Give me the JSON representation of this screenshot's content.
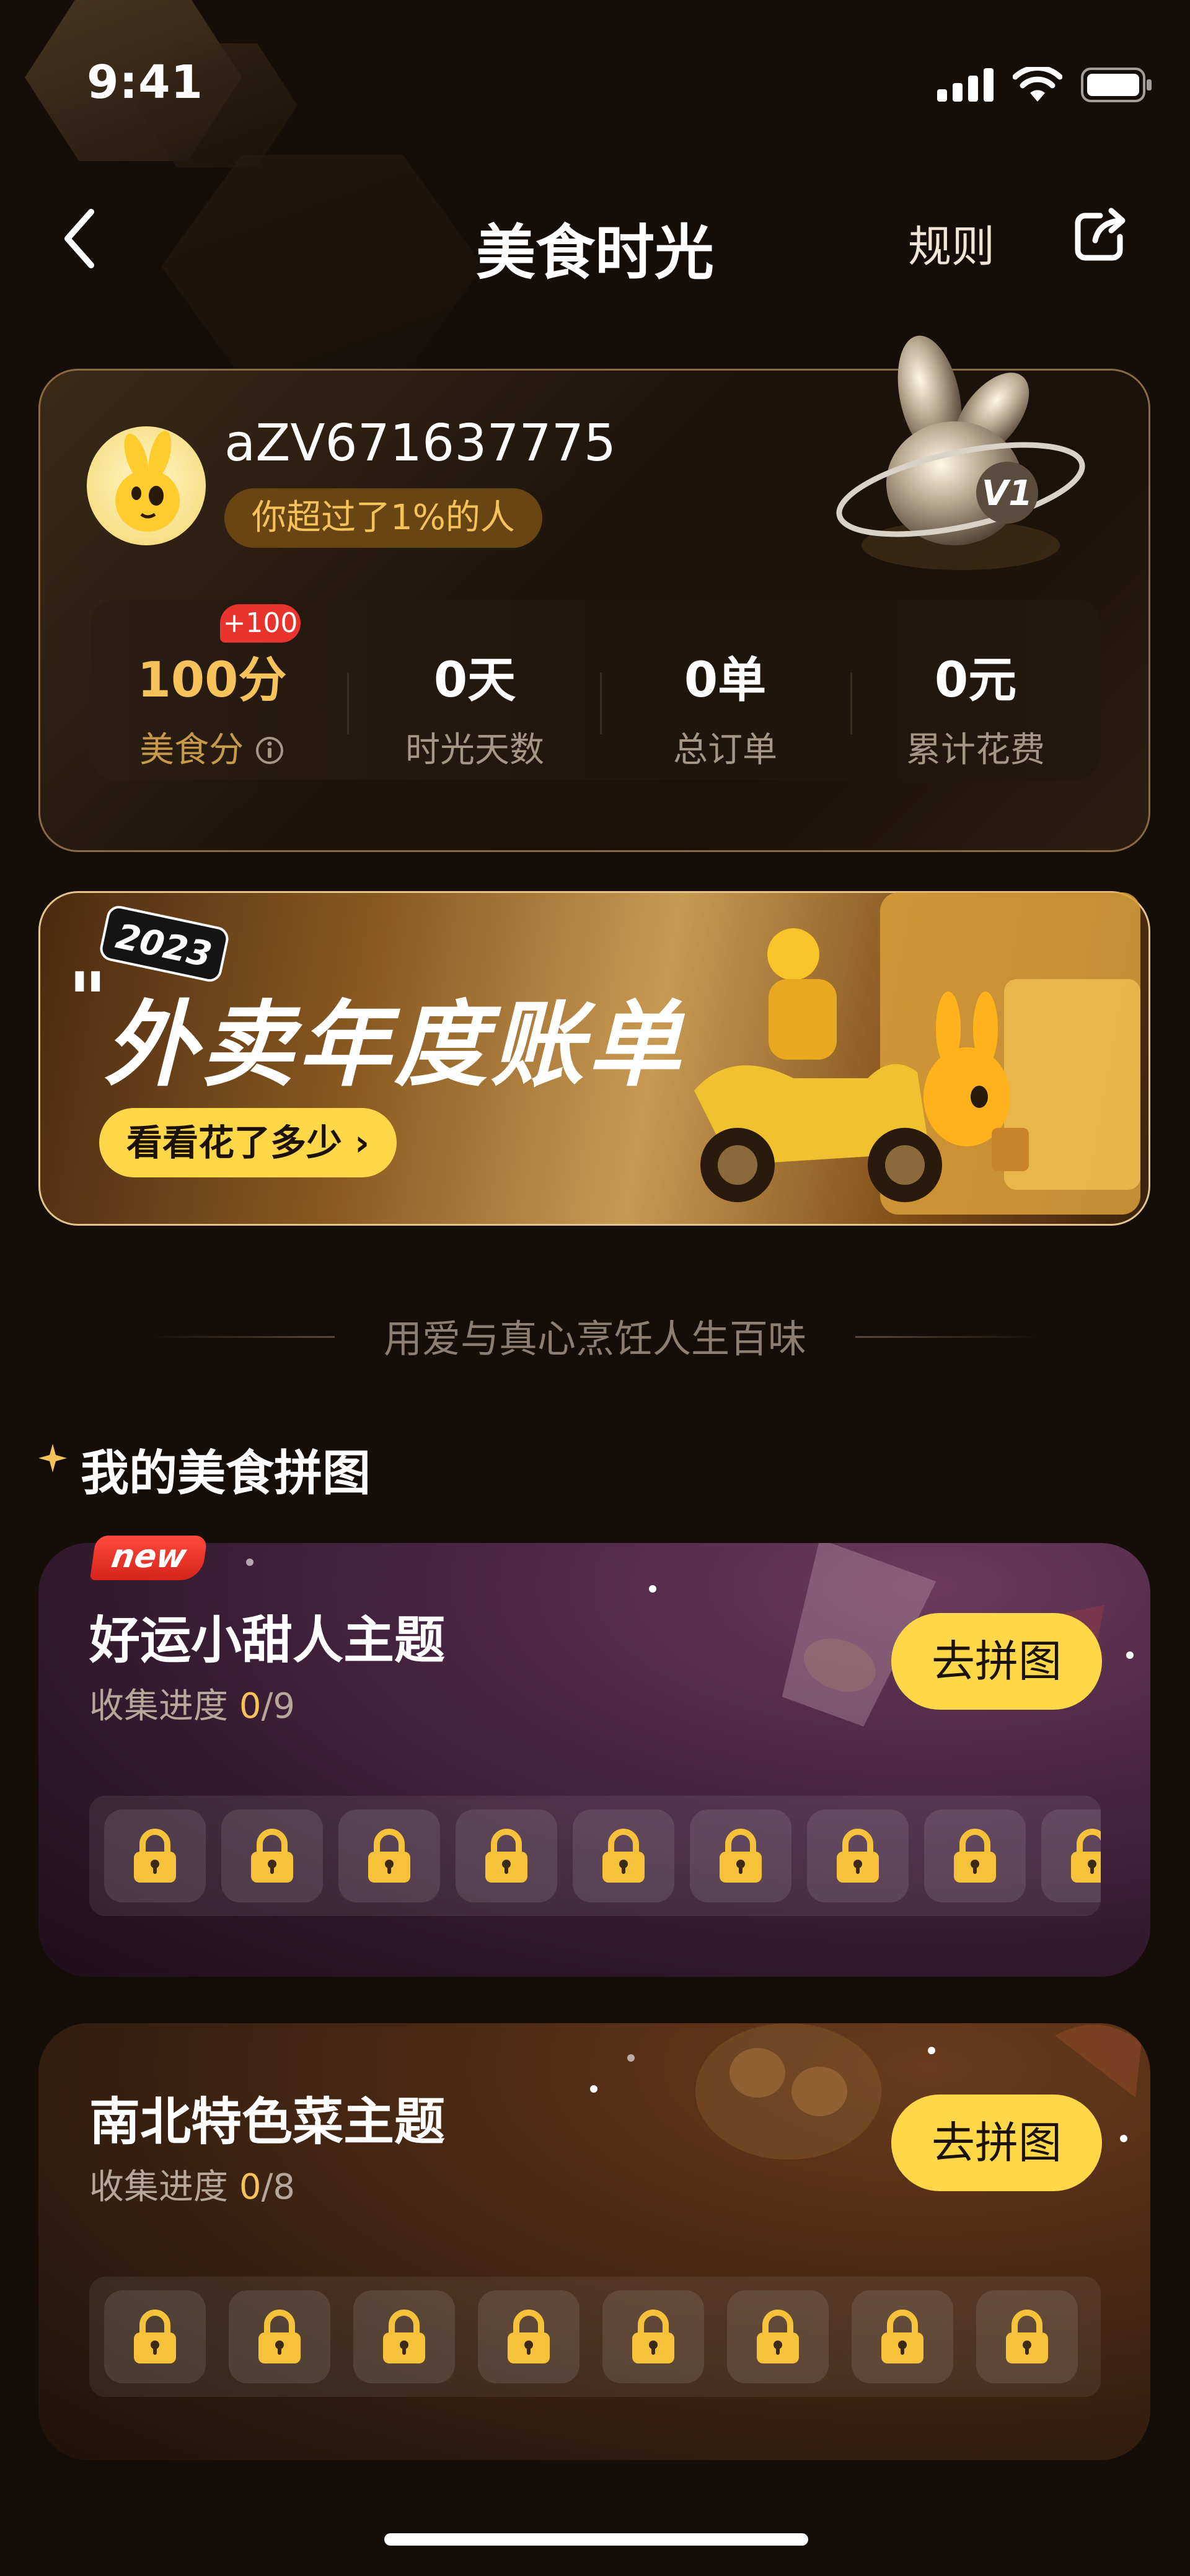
{
  "status_bar": {
    "time": "9:41"
  },
  "nav": {
    "title": "美食时光",
    "rules": "规则"
  },
  "profile": {
    "username": "aZV671637775",
    "rank_text": "你超过了1%的人",
    "level": "V1",
    "stats": [
      {
        "value": "100分",
        "label": "美食分",
        "badge": "+100"
      },
      {
        "value": "0天",
        "label": "时光天数"
      },
      {
        "value": "0单",
        "label": "总订单"
      },
      {
        "value": "0元",
        "label": "累计花费"
      }
    ]
  },
  "banner": {
    "year": "2023",
    "quote": "\"",
    "title": "外卖年度账单",
    "button": "看看花了多少 ›"
  },
  "slogan": "用爱与真心烹饪人生百味",
  "section": {
    "title": "我的美食拼图"
  },
  "themes": [
    {
      "tag": "new",
      "name": "好运小甜人主题",
      "progress_label": "收集进度 ",
      "collected": "0",
      "total": "/9",
      "button": "去拼图",
      "pieces": 9
    },
    {
      "name": "南北特色菜主题",
      "progress_label": "收集进度 ",
      "collected": "0",
      "total": "/8",
      "button": "去拼图",
      "pieces": 8
    }
  ],
  "colors": {
    "accent_yellow": "#ffd84a",
    "gold_text": "#f6c25a",
    "badge_red": "#e8342d",
    "background": "#140d08"
  },
  "icons": [
    "back-icon",
    "share-icon",
    "signal-icon",
    "wifi-icon",
    "battery-icon",
    "info-icon",
    "lock-icon",
    "star-icon"
  ]
}
